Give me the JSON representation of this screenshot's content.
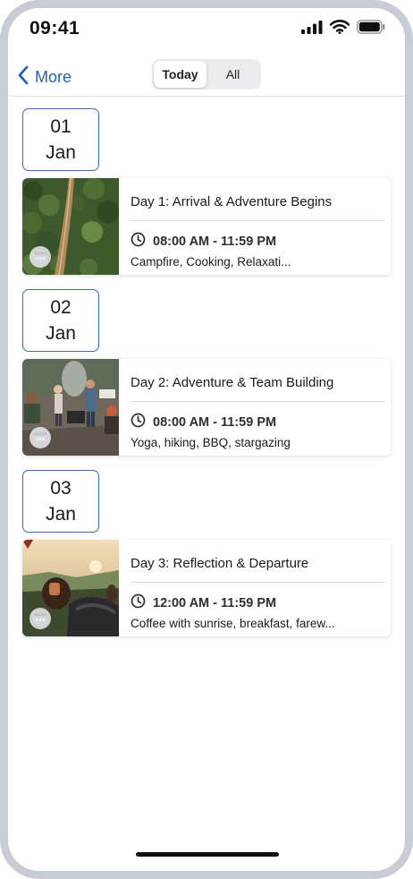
{
  "status_bar": {
    "time": "09:41",
    "icons": [
      "cellular-signal-icon",
      "wifi-icon",
      "battery-icon"
    ]
  },
  "nav": {
    "back_label": "More",
    "segments": [
      {
        "label": "Today",
        "selected": true
      },
      {
        "label": "All",
        "selected": false
      }
    ]
  },
  "days": [
    {
      "date_day": "01",
      "date_month": "Jan",
      "title": "Day 1: Arrival & Adventure Begins",
      "time": "08:00 AM - 11:59 PM",
      "description": "Campfire, Cooking, Relaxati..."
    },
    {
      "date_day": "02",
      "date_month": "Jan",
      "title": "Day 2: Adventure & Team Building",
      "time": "08:00 AM - 11:59 PM",
      "description": "Yoga, hiking, BBQ, stargazing"
    },
    {
      "date_day": "03",
      "date_month": "Jan",
      "title": "Day 3: Reflection & Departure",
      "time": "12:00 AM - 11:59 PM",
      "description": "Coffee with sunrise, breakfast, farew..."
    }
  ],
  "colors": {
    "accent": "#1f62b7",
    "date_border": "#3a6fb0",
    "frame": "#c8cdd5"
  }
}
